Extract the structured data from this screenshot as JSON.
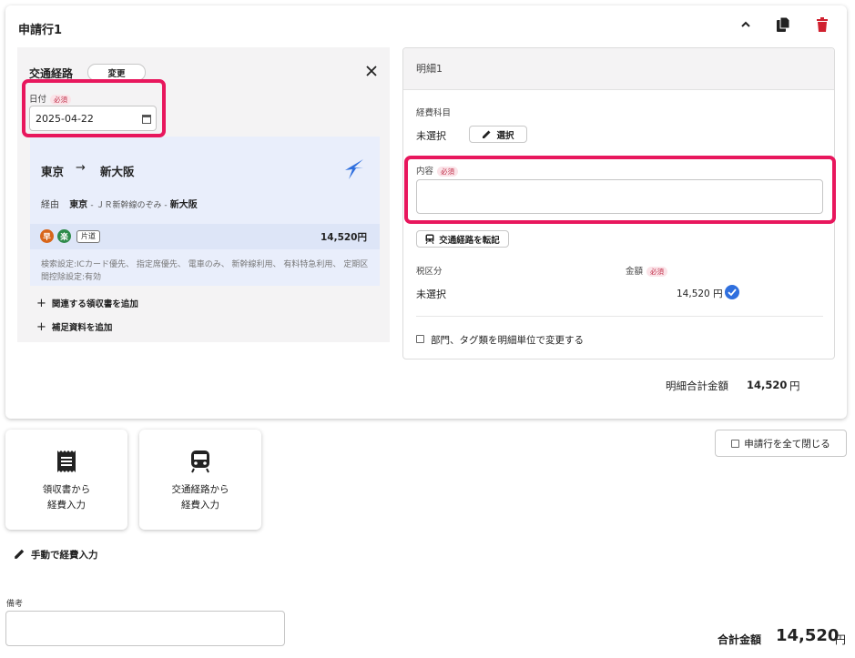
{
  "line": {
    "title": "申請行1",
    "route_section": {
      "title": "交通経路",
      "change_label": "変更",
      "date_label": "日付",
      "required_label": "必須",
      "date_value": "2025-04-22",
      "from": "東京",
      "arrow": "→",
      "to": "新大阪",
      "via_label": "経由",
      "via_from": "東京",
      "via_line": "- ＪＲ新幹線のぞみ -",
      "via_to": "新大阪",
      "badge_fast": "早",
      "badge_easy": "楽",
      "badge_oneway": "片道",
      "price": "14,520円",
      "search_settings": "検索設定:ICカード優先、 指定席優先、 電車のみ、 新幹線利用、 有料特急利用、 定期区間控除設定:有効",
      "add_receipt": "関連する領収書を追加",
      "add_material": "補足資料を追加"
    },
    "detail": {
      "title": "明細1",
      "expense_item_label": "経費科目",
      "expense_item_value": "未選択",
      "select_label": "選択",
      "content_label": "内容",
      "required_label": "必須",
      "content_value": "",
      "transfer_route_label": "交通経路を転記",
      "tax_label": "税区分",
      "tax_value": "未選択",
      "amount_label": "金額",
      "amount_required": "必須",
      "amount_value": "14,520 円",
      "dept_tag_label": "部門、タグ類を明細単位で変更する"
    },
    "detail_total_label": "明細合計金額",
    "detail_total_value": "14,520",
    "detail_total_unit": "円"
  },
  "actions": {
    "from_receipt": "領収書から\n経費入力",
    "from_route": "交通経路から\n経費入力",
    "manual": "手動で経費入力",
    "close_all": "申請行を全て閉じる"
  },
  "remarks": {
    "label": "備考",
    "value": ""
  },
  "total": {
    "label": "合計金額",
    "value": "14,520",
    "unit": "円"
  },
  "colors": {
    "accent_red": "#e8175d",
    "delete_red": "#d0202f",
    "check_blue": "#2f6fde",
    "badge_fast": "#d8661a",
    "badge_easy": "#2e8b4a"
  }
}
